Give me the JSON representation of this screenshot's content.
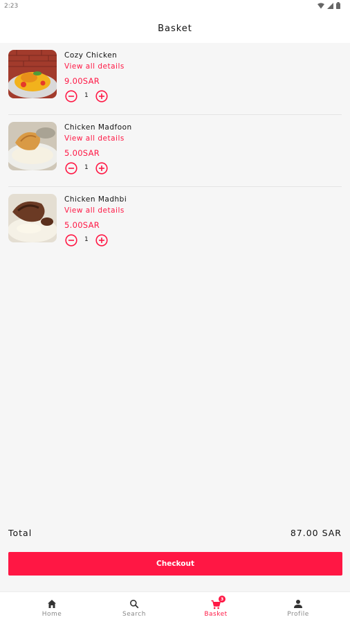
{
  "status_bar": {
    "time": "2:23"
  },
  "header": {
    "title": "Basket"
  },
  "items": [
    {
      "name": "Cozy Chicken",
      "details_label": "View all details",
      "price": "9.00SAR",
      "quantity": "1"
    },
    {
      "name": "Chicken Madfoon",
      "details_label": "View all details",
      "price": "5.00SAR",
      "quantity": "1"
    },
    {
      "name": "Chicken Madhbi",
      "details_label": "View all details",
      "price": "5.00SAR",
      "quantity": "1"
    }
  ],
  "summary": {
    "total_label": "Total",
    "total_value": "87.00 SAR"
  },
  "checkout": {
    "label": "Checkout"
  },
  "bottom_nav": {
    "items": [
      {
        "label": "Home",
        "icon": "home-icon"
      },
      {
        "label": "Search",
        "icon": "search-icon"
      },
      {
        "label": "Basket",
        "icon": "cart-icon",
        "badge": "3",
        "active": true
      },
      {
        "label": "Profile",
        "icon": "profile-icon"
      }
    ]
  },
  "colors": {
    "accent": "#ff1744",
    "background": "#f6f6f6"
  }
}
